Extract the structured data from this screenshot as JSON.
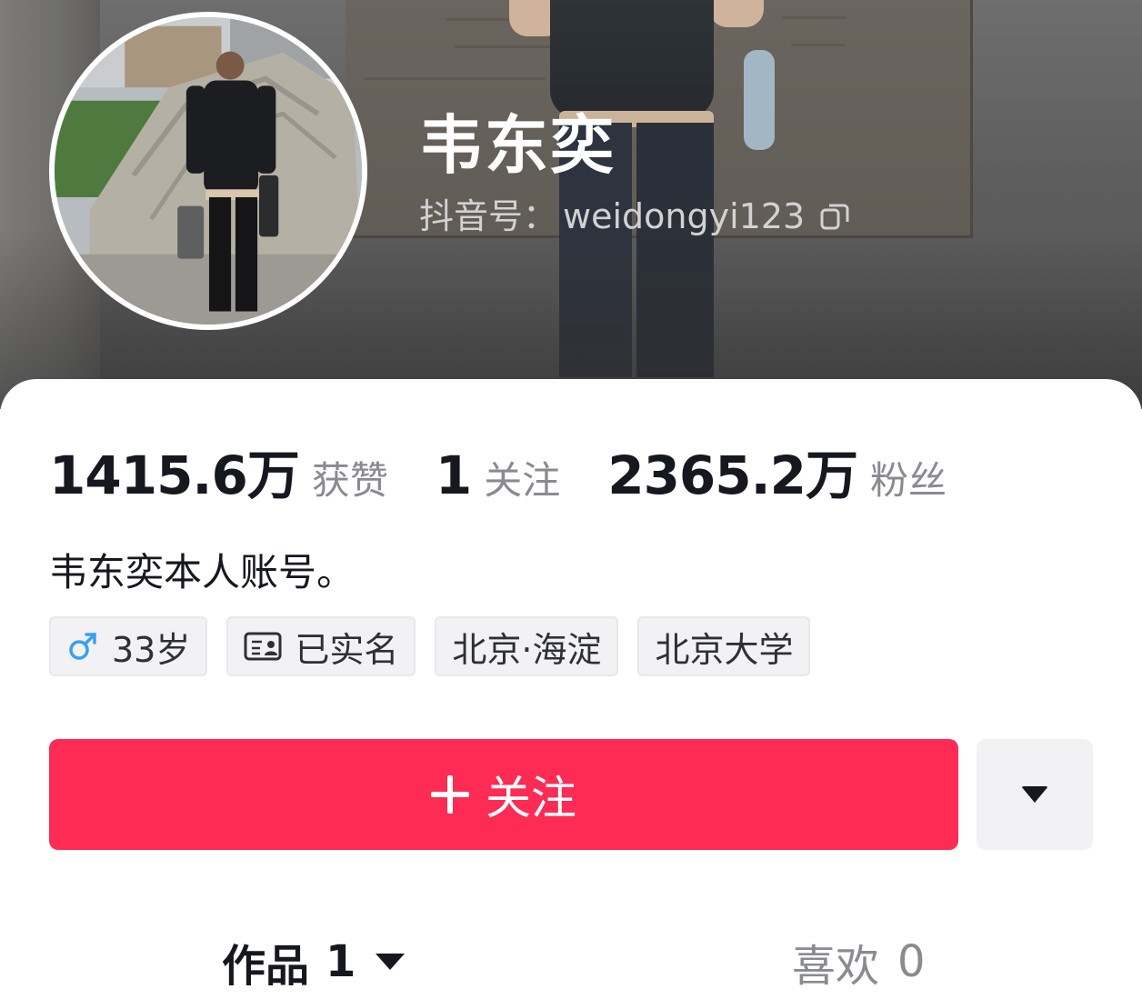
{
  "profile": {
    "name": "韦东奕",
    "id_label": "抖音号：",
    "id_value": "weidongyi123"
  },
  "stats": [
    {
      "value": "1415.6万",
      "label": "获赞"
    },
    {
      "value": "1",
      "label": "关注"
    },
    {
      "value": "2365.2万",
      "label": "粉丝"
    }
  ],
  "bio": "韦东奕本人账号。",
  "tags": {
    "age": "33岁",
    "verified": "已实名",
    "location": "北京·海淀",
    "school": "北京大学"
  },
  "actions": {
    "follow_label": "关注"
  },
  "tabs": {
    "works_label": "作品",
    "works_count": "1",
    "likes_label": "喜欢",
    "likes_count": "0"
  },
  "colors": {
    "accent": "#fe2c55",
    "text_primary": "#16181f",
    "text_secondary": "#8a8b91",
    "gender_icon": "#3aa0f0"
  },
  "icons": {
    "copy": "copy-icon",
    "gender": "male-icon",
    "verified": "id-card-icon",
    "plus": "plus-icon",
    "more": "caret-down-icon",
    "works_dropdown": "caret-down-icon"
  }
}
